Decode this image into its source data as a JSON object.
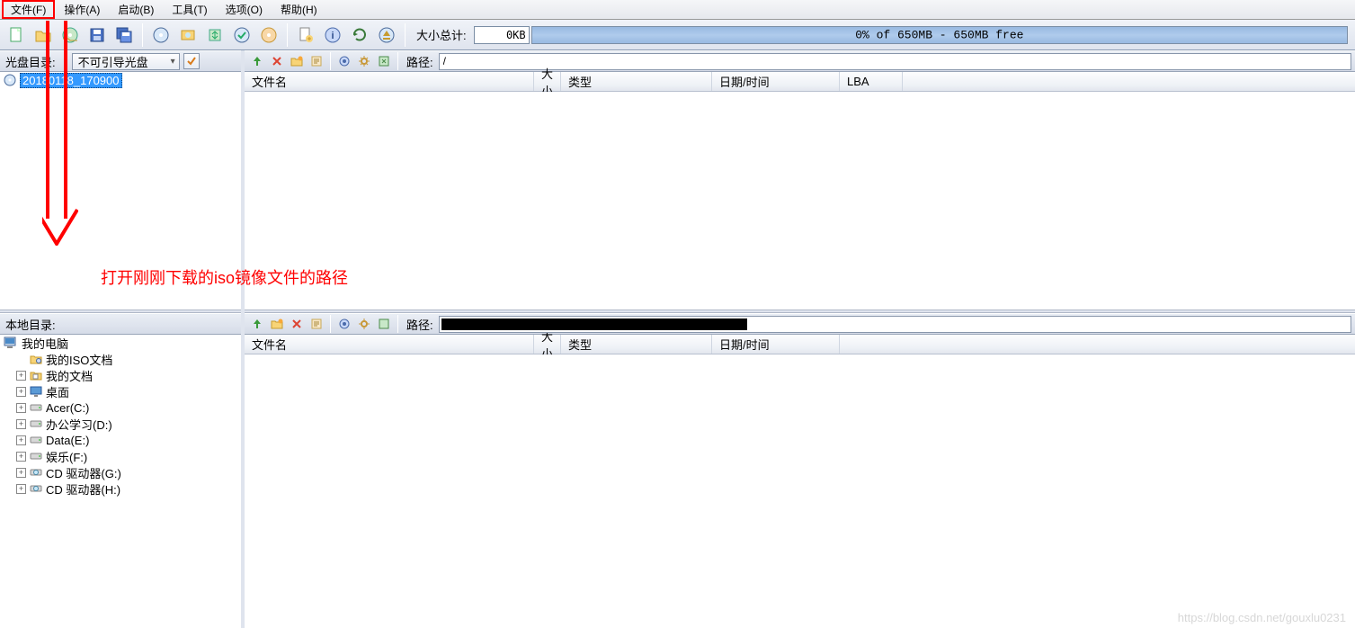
{
  "menu": {
    "file": "文件(F)",
    "action": "操作(A)",
    "boot": "启动(B)",
    "tools": "工具(T)",
    "options": "选项(O)",
    "help": "帮助(H)"
  },
  "toolbar": {
    "size_label": "大小总计:",
    "size_value": "0KB",
    "progress_text": "0% of 650MB - 650MB free"
  },
  "left_top": {
    "header_label": "光盘目录:",
    "dropdown_value": "不可引导光盘",
    "tree_root": "20180118_170900"
  },
  "left_bottom": {
    "header_label": "本地目录:",
    "tree": {
      "root": "我的电脑",
      "items": [
        {
          "label": "我的ISO文档",
          "icon": "folder-iso",
          "expandable": false,
          "indent": 1
        },
        {
          "label": "我的文档",
          "icon": "folder-docs",
          "expandable": true,
          "indent": 1
        },
        {
          "label": "桌面",
          "icon": "desktop",
          "expandable": true,
          "indent": 1
        },
        {
          "label": "Acer(C:)",
          "icon": "drive",
          "expandable": true,
          "indent": 1
        },
        {
          "label": "办公学习(D:)",
          "icon": "drive",
          "expandable": true,
          "indent": 1
        },
        {
          "label": "Data(E:)",
          "icon": "drive",
          "expandable": true,
          "indent": 1
        },
        {
          "label": "娱乐(F:)",
          "icon": "drive",
          "expandable": true,
          "indent": 1
        },
        {
          "label": "CD 驱动器(G:)",
          "icon": "cd",
          "expandable": true,
          "indent": 1
        },
        {
          "label": "CD 驱动器(H:)",
          "icon": "cd",
          "expandable": true,
          "indent": 1
        }
      ]
    }
  },
  "right_top": {
    "path_label": "路径:",
    "path_value": "/",
    "columns": {
      "name": "文件名",
      "size": "大小",
      "type": "类型",
      "date": "日期/时间",
      "lba": "LBA"
    }
  },
  "right_bottom": {
    "path_label": "路径:",
    "path_value": "",
    "columns": {
      "name": "文件名",
      "size": "大小",
      "type": "类型",
      "date": "日期/时间"
    }
  },
  "annotation": {
    "text": "打开刚刚下载的iso镜像文件的路径"
  },
  "watermark": "https://blog.csdn.net/gouxlu0231"
}
